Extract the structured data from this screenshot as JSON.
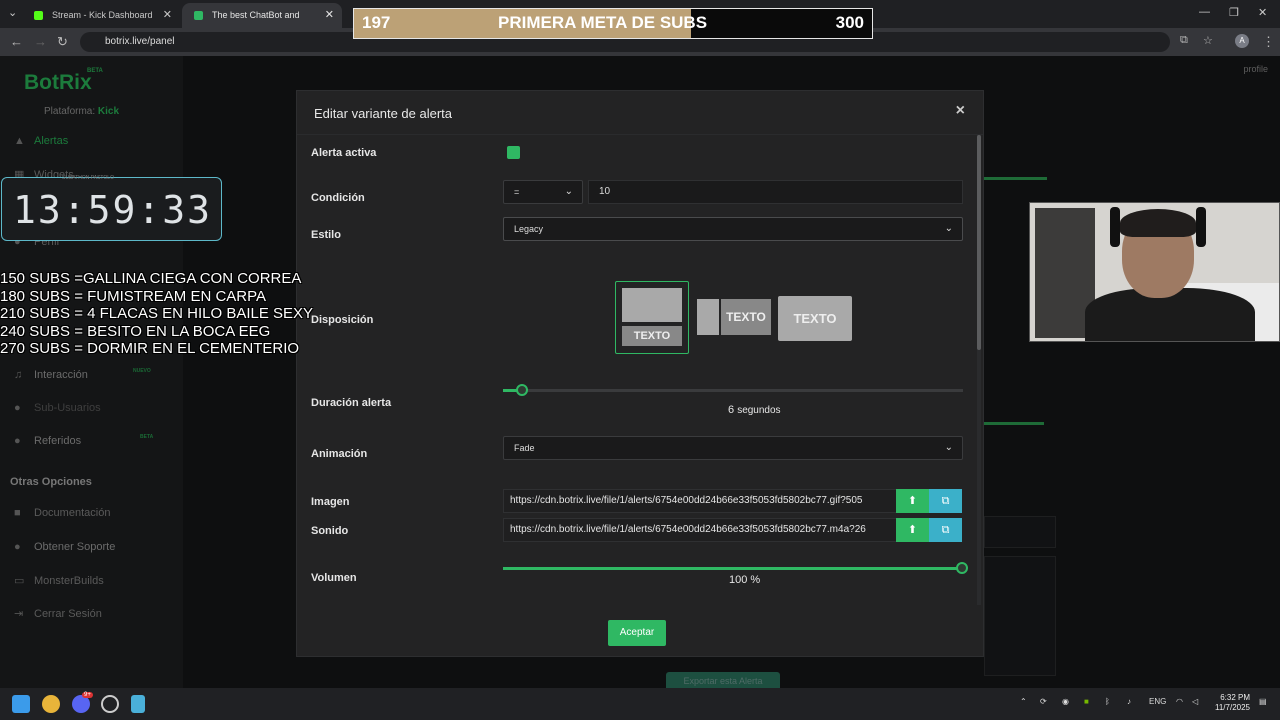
{
  "browser": {
    "tabs": [
      {
        "label": "Stream - Kick Dashboard"
      },
      {
        "label": "The best ChatBot and Widgets"
      }
    ],
    "url": "botrix.live/panel"
  },
  "sidebar": {
    "logo": "BotRix",
    "beta": "BETA",
    "platform_label": "Plataforma:",
    "platform_value": "Kick",
    "items": [
      {
        "label": "Alertas",
        "icon": "warning-icon"
      },
      {
        "label": "Widgets",
        "icon": "widgets-icon"
      },
      {
        "label": "Perfil",
        "icon": "user-icon"
      },
      {
        "label": "Interacción",
        "icon": "music-icon"
      },
      {
        "label": "Sub-Usuarios",
        "icon": "users-icon"
      },
      {
        "label": "Referidos",
        "icon": "referrals-icon"
      }
    ],
    "nuevo": "NUEVO",
    "beta_tag": "BETA",
    "section": "Otras Opciones",
    "other": [
      {
        "label": "Documentación",
        "icon": "docs-icon"
      },
      {
        "label": "Obtener Soporte",
        "icon": "support-icon"
      },
      {
        "label": "MonsterBuilds",
        "icon": "monitor-icon"
      },
      {
        "label": "Cerrar Sesión",
        "icon": "logout-icon"
      }
    ]
  },
  "profile": "profile",
  "export_button": "Exportar esta Alerta",
  "modal": {
    "title": "Editar variante de alerta",
    "close": "×",
    "labels": {
      "active": "Alerta activa",
      "condition": "Condición",
      "style": "Estilo",
      "layout": "Disposición",
      "duration": "Duración alerta",
      "animation": "Animación",
      "image": "Imagen",
      "sound": "Sonido",
      "volume": "Volumen"
    },
    "active": true,
    "condition_op": "=",
    "condition_value": "10",
    "style_value": "Legacy",
    "layout_text": "TEXTO",
    "duration_value": "6",
    "duration_unit": "segundos",
    "duration_fraction": 0.043,
    "animation_value": "Fade",
    "image_url": "https://cdn.botrix.live/file/1/alerts/6754e00dd24b66e33f5053fd5802bc77.gif?505",
    "sound_url": "https://cdn.botrix.live/file/1/alerts/6754e00dd24b66e33f5053fd5802bc77.m4a?26",
    "volume_value": "100",
    "volume_unit": "%",
    "accept": "Aceptar"
  },
  "overlay": {
    "goal_current": "197",
    "goal_title": "PRIMERA META DE SUBS",
    "goal_target": "300",
    "timer": "13:59:33",
    "timer_caption": "SUBATHON PASTOLO",
    "subs_lines": [
      "150 SUBS =GALLINA CIEGA CON CORREA",
      "180 SUBS = FUMISTREAM EN CARPA",
      "210 SUBS = 4 FLACAS EN HILO BAILE SEXY",
      "240 SUBS = BESITO EN LA BOCA EEG",
      "270 SUBS = DORMIR EN EL CEMENTERIO"
    ]
  },
  "taskbar": {
    "lang": "ENG",
    "time": "6:32 PM",
    "date": "11/7/2025",
    "badge": "9+"
  }
}
